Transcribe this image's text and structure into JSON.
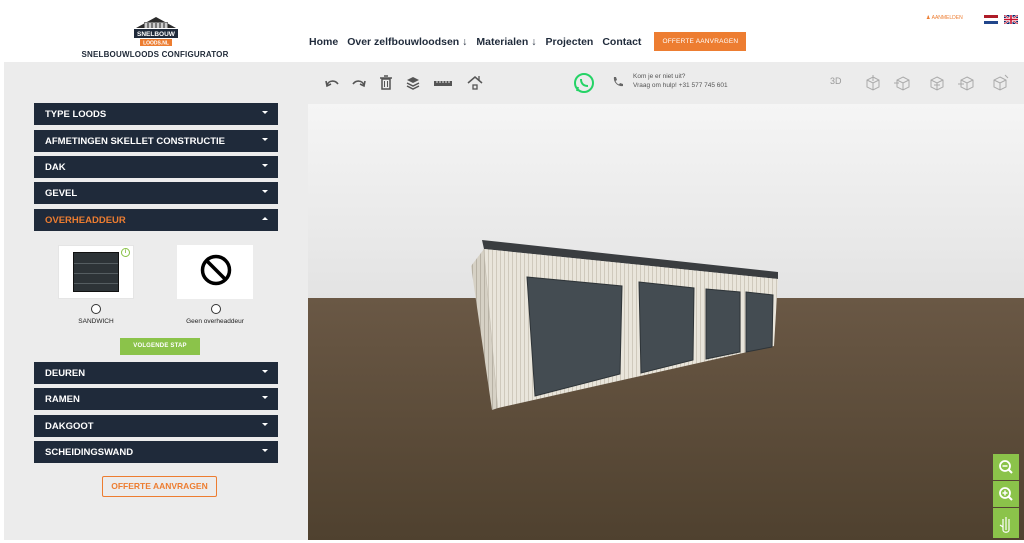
{
  "header": {
    "logo_text_top": "SNELBOUW",
    "logo_text_bottom": "LOODS.NL",
    "logo_subtitle": "SNELBOUWLOODS CONFIGURATOR",
    "nav": [
      {
        "label": "Home"
      },
      {
        "label": "Over zelfbouwloodsen ↓"
      },
      {
        "label": "Materialen ↓"
      },
      {
        "label": "Projecten"
      },
      {
        "label": "Contact"
      }
    ],
    "cta_label": "OFFERTE AANVRAGEN",
    "login_label": "AANMELDEN",
    "languages": [
      "nl-flag-icon",
      "en-flag-icon"
    ]
  },
  "sidebar": {
    "sections": [
      {
        "label": "TYPE LOODS",
        "open": false
      },
      {
        "label": "AFMETINGEN SKELLET CONSTRUCTIE",
        "open": false
      },
      {
        "label": "DAK",
        "open": false
      },
      {
        "label": "GEVEL",
        "open": false
      },
      {
        "label": "OVERHEADDEUR",
        "open": true
      },
      {
        "label": "DEUREN",
        "open": false
      },
      {
        "label": "RAMEN",
        "open": false
      },
      {
        "label": "DAKGOOT",
        "open": false
      },
      {
        "label": "SCHEIDINGSWAND",
        "open": false
      }
    ],
    "options": [
      {
        "label": "SANDWICH",
        "icon": "sandwich-panel-door-icon",
        "info": "i"
      },
      {
        "label": "Geen overheaddeur",
        "icon": "no-entry-icon"
      }
    ],
    "next_label": "VOLGENDE STAP",
    "quote_label": "OFFERTE AANVRAGEN"
  },
  "toolbar": {
    "tools": [
      "undo-icon",
      "redo-icon",
      "trash-icon",
      "layers-icon",
      "ruler-icon",
      "house-icon"
    ],
    "help_line1": "Kom je er niet uit?",
    "help_line2": "Vraag om hulp! +31 577 745 601",
    "view_3d_label": "3D",
    "views": [
      "top-view-icon",
      "left-view-icon",
      "front-view-icon",
      "right-view-icon",
      "back-view-icon"
    ]
  },
  "zoom": [
    "zoom-out-icon",
    "zoom-in-icon",
    "pan-hand-icon"
  ],
  "colors": {
    "navy": "#1f2a3a",
    "accent": "#ed7d31",
    "green": "#8bc34a",
    "whatsapp": "#25d366",
    "sidebar_bg": "#ececec"
  }
}
